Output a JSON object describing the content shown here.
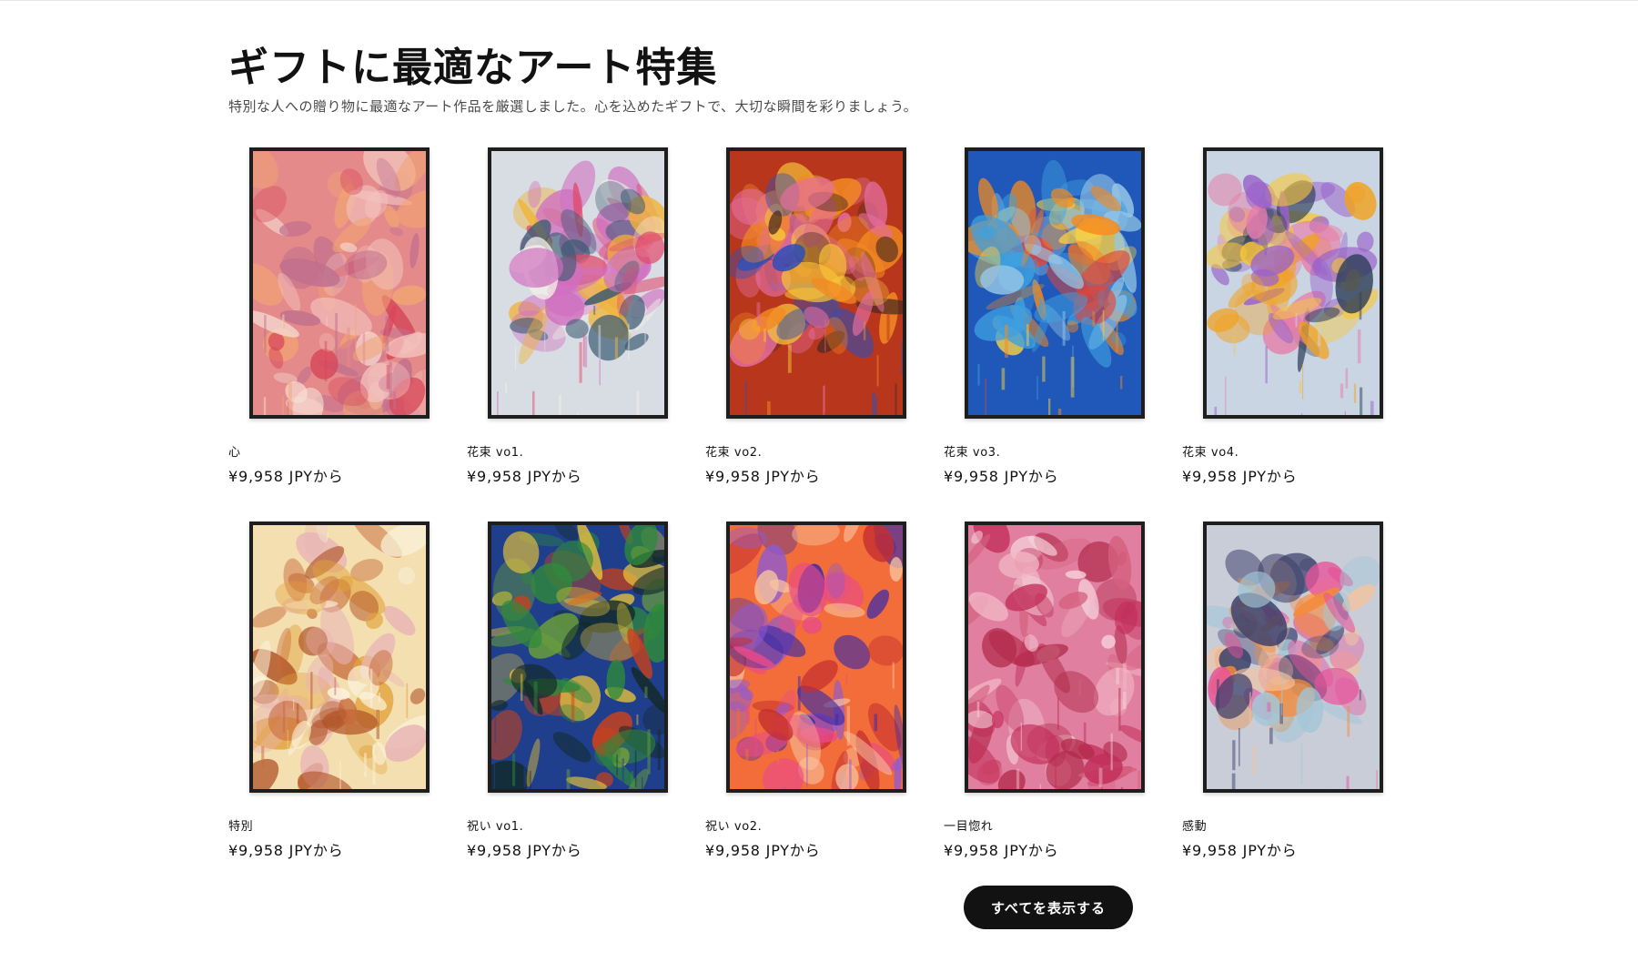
{
  "section": {
    "title": "ギフトに最適なアート特集",
    "subtitle": "特別な人への贈り物に最適なアート作品を厳選しました。心を込めたギフトで、大切な瞬間を彩りましょう。"
  },
  "products": [
    {
      "title": "心",
      "price": "¥9,958 JPYから",
      "image": "abstract-pink-artwork",
      "palette": [
        "#e58a8a",
        "#f3c2bd",
        "#d7485a",
        "#f6ddd4",
        "#c06f8e",
        "#f1a572"
      ]
    },
    {
      "title": "花束 vo1.",
      "price": "¥9,958 JPYから",
      "image": "flower-bouquet-artwork",
      "palette": [
        "#d8dde3",
        "#e04a6c",
        "#f0b43a",
        "#d06fc0",
        "#3a5a72",
        "#f3efe7"
      ]
    },
    {
      "title": "花束 vo2.",
      "price": "¥9,958 JPYから",
      "image": "flower-bouquet-artwork",
      "palette": [
        "#b8361c",
        "#f38a22",
        "#f6c33a",
        "#e46ea0",
        "#2e4fb8",
        "#4a2a1e"
      ]
    },
    {
      "title": "花束 vo3.",
      "price": "¥9,958 JPYから",
      "image": "flower-bouquet-artwork",
      "palette": [
        "#1f58b8",
        "#f58a1e",
        "#f8d046",
        "#3fa0e0",
        "#e0463a",
        "#96c7e6"
      ]
    },
    {
      "title": "花束 vo4.",
      "price": "¥9,958 JPYから",
      "image": "flower-bouquet-artwork",
      "palette": [
        "#c9d5e3",
        "#f2a11e",
        "#f7c73a",
        "#9a62c9",
        "#e67ea8",
        "#2f3f5a"
      ]
    },
    {
      "title": "特別",
      "price": "¥9,958 JPYから",
      "image": "abstract-warm-artwork",
      "palette": [
        "#f3dfb0",
        "#e2a23c",
        "#c86a3a",
        "#fbf3dc",
        "#e8b3b6",
        "#b05226"
      ]
    },
    {
      "title": "祝い vo1.",
      "price": "¥9,958 JPYから",
      "image": "abstract-green-blue-artwork",
      "palette": [
        "#1f3f8c",
        "#2f8a3a",
        "#e6c23a",
        "#c5421e",
        "#122a2a",
        "#6a9e3a"
      ]
    },
    {
      "title": "祝い vo2.",
      "price": "¥9,958 JPYから",
      "image": "abstract-vivid-artwork",
      "palette": [
        "#f26d3a",
        "#e94a8a",
        "#3b2aa8",
        "#f9c5a0",
        "#c52e2e",
        "#8a5ad8"
      ]
    },
    {
      "title": "一目惚れ",
      "price": "¥9,958 JPYから",
      "image": "abstract-pink-texture-artwork",
      "palette": [
        "#e07fa0",
        "#f2b7c6",
        "#c22e5a",
        "#f6d3dc",
        "#d5607e",
        "#b22a4a"
      ]
    },
    {
      "title": "感動",
      "price": "¥9,958 JPYから",
      "image": "abstract-bouquet-artwork",
      "palette": [
        "#c9cdd8",
        "#e5539a",
        "#f58a3a",
        "#3a3f6a",
        "#a3c7d8",
        "#f2c4a0"
      ]
    }
  ],
  "actions": {
    "view_all_label": "すべてを表示する"
  }
}
